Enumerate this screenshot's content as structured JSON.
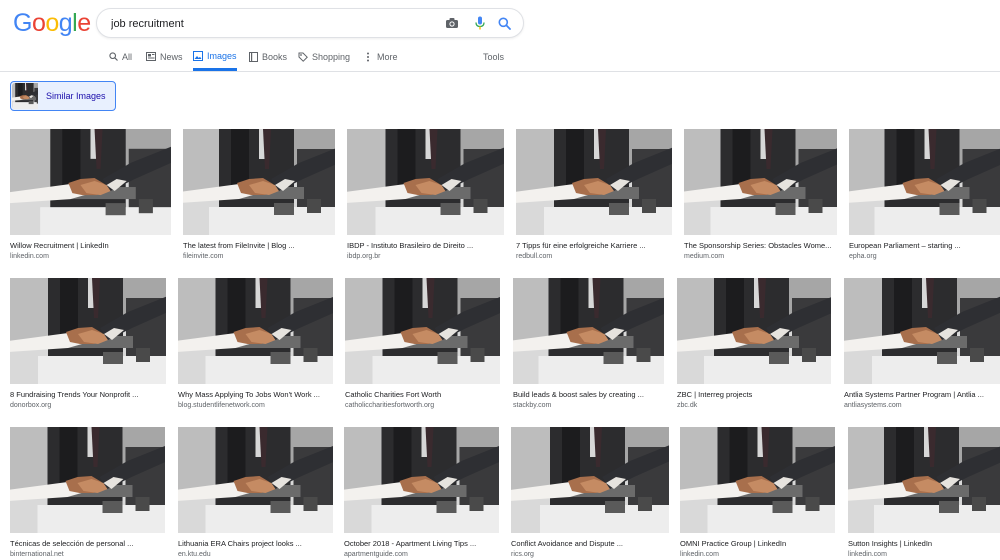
{
  "logo": {
    "letters": [
      "G",
      "o",
      "o",
      "g",
      "l",
      "e"
    ],
    "colors": [
      "#4285F4",
      "#EA4335",
      "#FBBC05",
      "#4285F4",
      "#34A853",
      "#EA4335"
    ]
  },
  "search": {
    "value": "job recruitment"
  },
  "icons": {
    "camera": "camera-icon",
    "mic": "mic-icon",
    "search": "search-icon"
  },
  "tabs": [
    {
      "label": "All",
      "icon": "search-icon"
    },
    {
      "label": "News",
      "icon": "news-icon"
    },
    {
      "label": "Images",
      "icon": "image-icon",
      "active": true
    },
    {
      "label": "Books",
      "icon": "book-icon"
    },
    {
      "label": "Shopping",
      "icon": "tag-icon"
    },
    {
      "label": "More",
      "icon": "more-icon"
    }
  ],
  "tools_label": "Tools",
  "similar_images_label": "Similar Images",
  "accent": "#1a73e8",
  "results": [
    [
      {
        "title": "Willow Recruitment | LinkedIn",
        "domain": "linkedin.com"
      },
      {
        "title": "The latest from FileInvite | Blog ...",
        "domain": "fileinvite.com"
      },
      {
        "title": "IBDP - Instituto Brasileiro de Direito ...",
        "domain": "ibdp.org.br"
      },
      {
        "title": "7 Tipps für eine erfolgreiche Karriere ...",
        "domain": "redbull.com"
      },
      {
        "title": "The Sponsorship Series: Obstacles Wome...",
        "domain": "medium.com"
      },
      {
        "title": "European Parliament – starting ...",
        "domain": "epha.org"
      }
    ],
    [
      {
        "title": "8 Fundraising Trends Your Nonprofit ...",
        "domain": "donorbox.org"
      },
      {
        "title": "Why Mass Applying To Jobs Won't Work ...",
        "domain": "blog.studentlifenetwork.com"
      },
      {
        "title": "Catholic Charities Fort Worth",
        "domain": "catholiccharitiesfortworth.org"
      },
      {
        "title": "Build leads & boost sales by creating ...",
        "domain": "stackby.com"
      },
      {
        "title": "ZBC | Interreg projects",
        "domain": "zbc.dk"
      },
      {
        "title": "Antlia Systems Partner Program | Antlia ...",
        "domain": "antliasystems.com"
      }
    ],
    [
      {
        "title": "Técnicas de selección de personal ...",
        "domain": "binternational.net"
      },
      {
        "title": "Lithuania ERA Chairs project looks ...",
        "domain": "en.ktu.edu"
      },
      {
        "title": "October 2018 - Apartment Living Tips ...",
        "domain": "apartmentguide.com"
      },
      {
        "title": "Conflict Avoidance and Dispute ...",
        "domain": "rics.org"
      },
      {
        "title": "OMNI Practice Group | LinkedIn",
        "domain": "linkedin.com"
      },
      {
        "title": "Sutton Insights | LinkedIn",
        "domain": "linkedin.com"
      }
    ]
  ]
}
